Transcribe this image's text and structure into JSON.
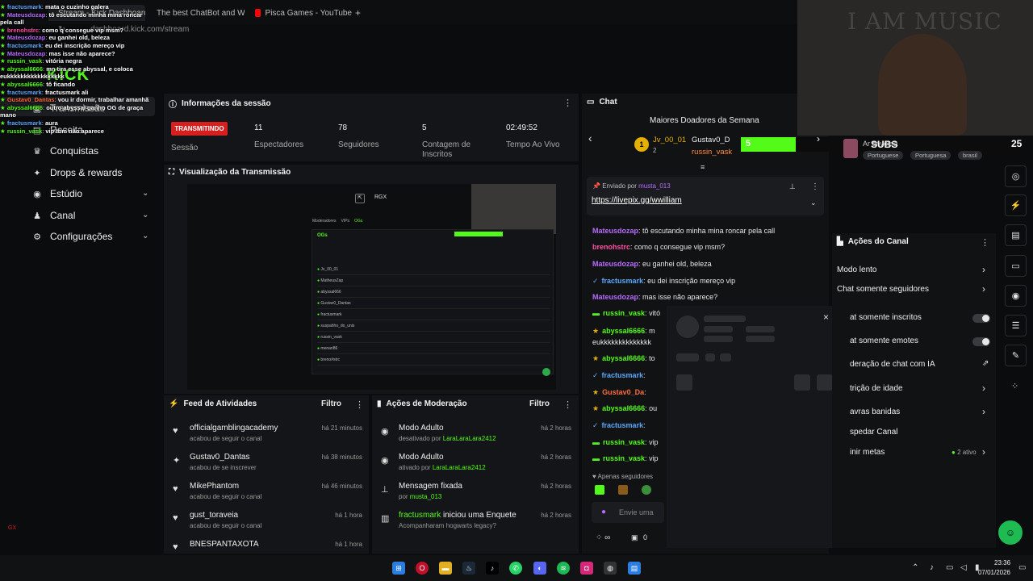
{
  "browser": {
    "tabs": [
      {
        "label": "Stream - Kick Dashboard",
        "color": "#53fc18"
      },
      {
        "label": "The best ChatBot and Wid",
        "color": "#8a6df0"
      },
      {
        "label": "Pisca Games - YouTube",
        "color": "#ff0000"
      }
    ],
    "new_tab": "+",
    "url": "dashboard.kick.com/stream"
  },
  "overlay_chat": [
    {
      "user": "fractusmark",
      "msg": "mata o cuzinho galera",
      "color": "#5aa9ff"
    },
    {
      "user": "Mateusdozap",
      "msg": "tô escutando minha mina roncar pela call",
      "color": "#b86bff"
    },
    {
      "user": "brenohstrc",
      "msg": "como q consegue vip msm?",
      "color": "#ff4fa3"
    },
    {
      "user": "Mateusdozap",
      "msg": "eu ganhei old, beleza",
      "color": "#b86bff"
    },
    {
      "user": "fractusmark",
      "msg": "eu dei inscrição mereço vip",
      "color": "#5aa9ff"
    },
    {
      "user": "Mateusdozap",
      "msg": "mas isse não aparece?",
      "color": "#b86bff"
    },
    {
      "user": "russin_vask",
      "msg": "vitória negra",
      "color": "#53fc18"
    },
    {
      "user": "abyssal6666",
      "msg": "mn tira esse abyssal, e coloca eukkkkkkkkkkkkkkkkk",
      "color": "#53fc18"
    },
    {
      "user": "abyssal6666",
      "msg": "tô ficando",
      "color": "#53fc18"
    },
    {
      "user": "fractusmark",
      "msg": "fractusmark ali",
      "color": "#5aa9ff"
    },
    {
      "user": "Gustav0_Dantas",
      "msg": "vou ir dormir, trabalhar amanhã",
      "color": "#ff6a3d"
    },
    {
      "user": "abyssal6666",
      "msg": "outro abyssal ganho OG de graça mano",
      "color": "#53fc18"
    },
    {
      "user": "fractusmark",
      "msg": "aura",
      "color": "#5aa9ff"
    },
    {
      "user": "russin_vask",
      "msg": "vip tbm não aparece",
      "color": "#53fc18"
    }
  ],
  "sidebar": {
    "items": [
      {
        "label": "Transmissão",
        "icon": "broadcast-icon"
      },
      {
        "label": "Receita",
        "icon": "receipt-icon"
      },
      {
        "label": "Conquistas",
        "icon": "trophy-icon"
      },
      {
        "label": "Drops & rewards",
        "icon": "gift-icon"
      },
      {
        "label": "Estúdio",
        "icon": "studio-icon"
      },
      {
        "label": "Canal",
        "icon": "channel-icon"
      },
      {
        "label": "Configurações",
        "icon": "gear-icon"
      }
    ]
  },
  "session": {
    "title": "Informações da sessão",
    "status": "TRANSMITINDO",
    "status_label": "Sessão",
    "stats": [
      {
        "value": "11",
        "label": "Espectadores"
      },
      {
        "value": "78",
        "label": "Seguidores"
      },
      {
        "value": "5",
        "label": "Contagem de Inscritos"
      },
      {
        "value": "02:49:52",
        "label": "Tempo Ao Vivo"
      }
    ]
  },
  "preview": {
    "title": "Visualização da Transmissão",
    "overlay_label": "RGX",
    "inner_title": "OGs",
    "inner_tabs": [
      "Moderadores",
      "VIPs",
      "OGs"
    ],
    "inner_rows": [
      "Jv_00_01",
      "MatheusZap",
      "abyssal666",
      "Gustav0_Dantas",
      "fractusmark",
      "suspahho_do_unis",
      "russin_vask",
      "menari86",
      "breno#strc"
    ]
  },
  "activity": {
    "title": "Feed de Atividades",
    "filter": "Filtro",
    "items": [
      {
        "name": "officialgamblingacademy",
        "sub": "acabou de seguir o canal",
        "time": "há 21 minutos",
        "icon": "heart-icon"
      },
      {
        "name": "Gustav0_Dantas",
        "sub": "acabou de se inscrever",
        "time": "há 38 minutos",
        "icon": "star-icon"
      },
      {
        "name": "MikePhantom",
        "sub": "acabou de seguir o canal",
        "time": "há 46 minutos",
        "icon": "heart-icon"
      },
      {
        "name": "gust_toraveia",
        "sub": "acabou de seguir o canal",
        "time": "há 1 hora",
        "icon": "heart-icon"
      },
      {
        "name": "BNESPANTAXOTA",
        "sub": "",
        "time": "há 1 hora",
        "icon": "heart-icon"
      }
    ]
  },
  "moderation": {
    "title": "Ações de Moderação",
    "filter": "Filtro",
    "items": [
      {
        "name": "Modo Adulto",
        "sub_pre": "desativado por",
        "sub_user": "LaraLaraLara2412",
        "time": "há 2 horas",
        "icon": "eye-icon"
      },
      {
        "name": "Modo Adulto",
        "sub_pre": "ativado por",
        "sub_user": "LaraLaraLara2412",
        "time": "há 2 horas",
        "icon": "eye-icon"
      },
      {
        "name": "Mensagem fixada",
        "sub_pre": "por",
        "sub_user": "musta_013",
        "time": "há 2 horas",
        "icon": "pin-icon"
      },
      {
        "name_user": "fractusmark",
        "name": "iniciou uma Enquete",
        "sub_pre": "Acompanharam hogwarts legacy?",
        "sub_user": "",
        "time": "há 2 horas",
        "icon": "poll-icon"
      }
    ]
  },
  "chat": {
    "title": "Chat",
    "donors_title": "Maiores Doadores da Semana",
    "donors": [
      {
        "name": "Jv_00_01",
        "amount": "2",
        "rank": "1"
      },
      {
        "name": "Gustav0_D",
        "amount": ""
      },
      {
        "name": "russin_vask",
        "amount": ""
      }
    ],
    "pinned_by_pre": "Enviado por",
    "pinned_by": "musta_013",
    "pinned_link": "https://livepix.gg/wwilliam",
    "messages": [
      {
        "user": "Mateusdozap",
        "msg": "tô escutando minha mina roncar pela call",
        "color": "#b86bff"
      },
      {
        "user": "brenohstrc",
        "msg": "como q consegue vip msm?",
        "color": "#ff4fa3"
      },
      {
        "user": "Mateusdozap",
        "msg": "eu ganhei old, beleza",
        "color": "#b86bff"
      },
      {
        "user": "fractusmark",
        "msg": "eu dei inscrição mereço vip",
        "color": "#5aa9ff"
      },
      {
        "user": "Mateusdozap",
        "msg": "mas isse não aparece?",
        "color": "#b86bff"
      },
      {
        "user": "russin_vask",
        "msg": "vitó",
        "color": "#53fc18"
      },
      {
        "user": "abyssal6666",
        "msg": "m",
        "color": "#53fc18"
      },
      {
        "user": "",
        "msg": "eukkkkkkkkkkkkkk",
        "color": "#e6e6e6"
      },
      {
        "user": "abyssal6666",
        "msg": "to",
        "color": "#53fc18"
      },
      {
        "user": "fractusmark",
        "msg": "",
        "color": "#5aa9ff"
      },
      {
        "user": "Gustav0_Da",
        "msg": "",
        "color": "#ff6a3d"
      },
      {
        "user": "abyssal6666",
        "msg": "ou",
        "color": "#53fc18"
      },
      {
        "user": "fractusmark",
        "msg": "",
        "color": "#5aa9ff"
      },
      {
        "user": "russin_vask",
        "msg": "vip",
        "color": "#53fc18"
      },
      {
        "user": "russin_vask",
        "msg": "vip",
        "color": "#53fc18"
      }
    ],
    "followers_only": "Apenas seguidores",
    "input_placeholder": "Envie uma",
    "count": "0"
  },
  "actions": {
    "title": "Ações do Canal",
    "items": [
      {
        "label": "Modo lento",
        "kind": "chevron"
      },
      {
        "label": "Chat somente seguidores",
        "kind": "chevron"
      },
      {
        "label": "at somente inscritos",
        "kind": "toggle"
      },
      {
        "label": "at somente emotes",
        "kind": "toggle"
      },
      {
        "label": "deração de chat com IA",
        "kind": "external"
      },
      {
        "label": "trição de idade",
        "kind": "chevron"
      },
      {
        "label": "avras banidas",
        "kind": "chevron"
      },
      {
        "label": "spedar Canal",
        "kind": "none"
      },
      {
        "label": "inir metas",
        "kind": "chevron",
        "badge": "2 ativo"
      }
    ]
  },
  "webcam": {
    "poster_text": "I AM MUSIC",
    "subs_label": "SUBS",
    "subs_count": "25",
    "subs_progress": "5",
    "top_label": "Ar     onversa",
    "tags": [
      "Portuguese",
      "Portuguesa",
      "brasil"
    ]
  },
  "taskbar": {
    "time": "23:36",
    "date": "07/01/2026"
  },
  "colors": {
    "kick_green": "#53fc18",
    "live_red": "#d61f1f",
    "panel_bg": "#141518",
    "page_bg": "#0b0c0e"
  }
}
